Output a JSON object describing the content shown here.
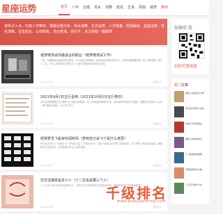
{
  "site": {
    "logo": "星座运势"
  },
  "nav": [
    "首页",
    "八字",
    "合婚",
    "风水",
    "测算",
    "姓名",
    "生肖",
    "周易",
    "解梦",
    "算命",
    "星座",
    "运势"
  ],
  "banner": {
    "text": "塔罗占卜术，印度八字算命、婚姻合婚分析、风水测算、生日运势、八字排盘、周易解卦、星座运势，姓名测算、宝宝起名、公司取名、吉凶查询、",
    "highlight": "微信号：",
    "tail": "关注获取一键解梦"
  },
  "posts": [
    {
      "title": "塔罗牌测试你最适合的职业（塔罗牌测试工作）",
      "desc": "人的一生都要经历各种各样的职业，可以通过塔罗牌测一测你最适合的职业是什么，你的性格更偏向哪一类？塔罗牌是一种占卜工具，它可以帮助我们了解自己，让我们在做选择时更有方向感。",
      "date": "2026-07-08",
      "more": "阅读全文"
    },
    {
      "title": "2021年4月2日五行喜用（2021年10月2日五行穿衣）",
      "desc": "五行喜用是根据出生日期的五行属性来判断的，是一种传统的命理学方法，每天都有不同的五行属性，根据五行穿衣可以让你一整天都好运连连，今日五行属土。",
      "date": "2026-07-08",
      "more": "阅读全文"
    },
    {
      "title": "经常梦见飞是有利润的吗（梦到自己会飞了是什么意思）",
      "desc": "梦见自己在天上飞代表什么？梦到自己会飞了预示着什么？很多人都有过在梦里飞翔的经历，这个梦境一般象征着自由、解脱和对生活的向往，也可能预示事业上会有突破。",
      "date": "2026-07-08",
      "more": "阅读全文"
    },
    {
      "title": "空乏往摄政是多少人（十二生肖是哪三个人）",
      "desc": "十二生肖三合六合的说法由来已久，不同生肖之间的相处方式也各有不同，想知道你的生肖和谁最配吗？",
      "date": "2026-07-08",
      "more": "阅读全文"
    }
  ],
  "sidebar": {
    "qr_title": "加微信 我",
    "qr_cta": "扫码可查信息",
    "hot_label": "热门",
    "hot_title": "文章",
    "hot_items": [
      "属兔人的运势怎么样",
      "梦见自己的家人去世",
      "生肖牛今年的财运",
      "属狗人的性格特点",
      "十二星座谁最聪明",
      "手相感情线怎么看",
      "八字五行缺什么好"
    ]
  },
  "watermark": {
    "text": "千级排名",
    "url": "www.qianjipaiming.com"
  },
  "colors": {
    "brand": "#e0584e",
    "banner": "#d8554c"
  }
}
